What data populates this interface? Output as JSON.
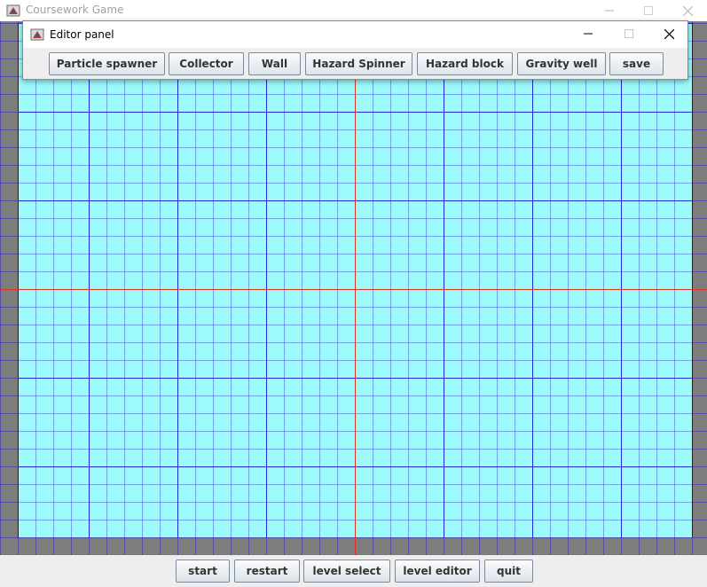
{
  "main_window": {
    "title": "Coursework Game"
  },
  "editor_panel": {
    "title": "Editor panel",
    "buttons": [
      {
        "label": "Particle spawner"
      },
      {
        "label": "Collector"
      },
      {
        "label": "Wall"
      },
      {
        "label": "Hazard Spinner"
      },
      {
        "label": "Hazard block"
      },
      {
        "label": "Gravity well"
      },
      {
        "label": "save"
      }
    ]
  },
  "bottom_bar": {
    "buttons": [
      {
        "label": "start"
      },
      {
        "label": "restart"
      },
      {
        "label": "level select"
      },
      {
        "label": "level editor"
      },
      {
        "label": "quit"
      }
    ]
  },
  "colors": {
    "playfield": "#9cfafb",
    "border_area": "#7d7d7d",
    "grid_line": "#1414d2",
    "axis_line": "#e0302a"
  },
  "icons": [
    "java-app-icon",
    "minimize-icon",
    "maximize-icon",
    "close-icon"
  ]
}
